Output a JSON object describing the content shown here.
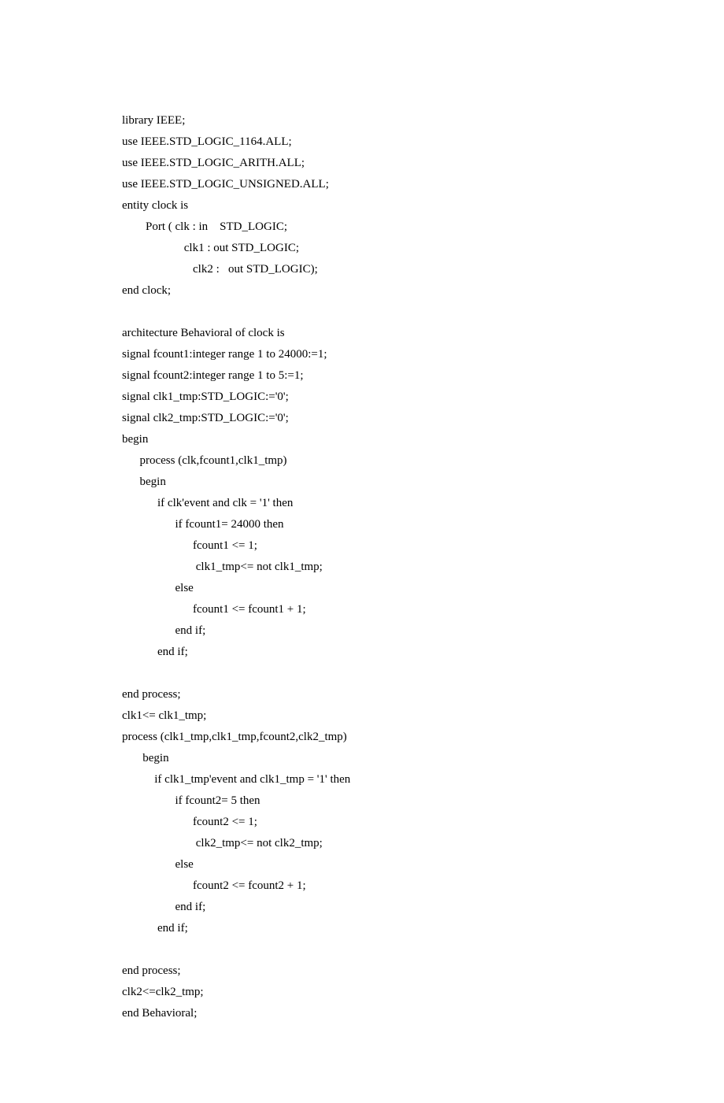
{
  "code": {
    "lines": [
      "library IEEE;",
      "use IEEE.STD_LOGIC_1164.ALL;",
      "use IEEE.STD_LOGIC_ARITH.ALL;",
      "use IEEE.STD_LOGIC_UNSIGNED.ALL;",
      "entity clock is",
      "        Port ( clk : in    STD_LOGIC;",
      "                     clk1 : out STD_LOGIC;",
      "                        clk2 :   out STD_LOGIC);",
      "end clock;",
      "",
      "architecture Behavioral of clock is",
      "signal fcount1:integer range 1 to 24000:=1;",
      "signal fcount2:integer range 1 to 5:=1;",
      "signal clk1_tmp:STD_LOGIC:='0';",
      "signal clk2_tmp:STD_LOGIC:='0';",
      "begin",
      "      process (clk,fcount1,clk1_tmp)",
      "      begin",
      "            if clk'event and clk = '1' then",
      "                  if fcount1= 24000 then",
      "                        fcount1 <= 1;",
      "                         clk1_tmp<= not clk1_tmp;",
      "                  else",
      "                        fcount1 <= fcount1 + 1;",
      "                  end if;",
      "            end if;",
      "",
      "end process;",
      "clk1<= clk1_tmp;",
      "process (clk1_tmp,clk1_tmp,fcount2,clk2_tmp)",
      "       begin",
      "           if clk1_tmp'event and clk1_tmp = '1' then",
      "                  if fcount2= 5 then",
      "                        fcount2 <= 1;",
      "                         clk2_tmp<= not clk2_tmp;",
      "                  else",
      "                        fcount2 <= fcount2 + 1;",
      "                  end if;",
      "            end if;",
      "",
      "end process;",
      "clk2<=clk2_tmp;",
      "end Behavioral;"
    ]
  }
}
